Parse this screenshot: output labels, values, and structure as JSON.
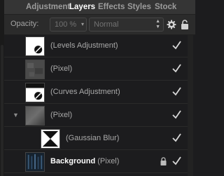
{
  "tabs": [
    {
      "label": "Adjustment",
      "active": false
    },
    {
      "label": "Layers",
      "active": true
    },
    {
      "label": "Effects",
      "active": false
    },
    {
      "label": "Styles",
      "active": false
    },
    {
      "label": "Stock",
      "active": false
    }
  ],
  "toolbar": {
    "opacity_label": "Opacity:",
    "opacity_value": "100 %",
    "blend_mode": "Normal",
    "gear_icon": "gear-icon",
    "lock_icon": "lock-icon"
  },
  "layers": [
    {
      "name": "(Levels Adjustment)",
      "bold_name": "",
      "thumb": "levels-adjustment-thumbnail",
      "visible": true,
      "locked": false,
      "child": false,
      "expandable": false
    },
    {
      "name": "(Pixel)",
      "bold_name": "",
      "thumb": "pixel-thumbnail",
      "visible": true,
      "locked": false,
      "child": false,
      "expandable": false
    },
    {
      "name": "(Curves Adjustment)",
      "bold_name": "",
      "thumb": "curves-adjustment-thumbnail",
      "visible": true,
      "locked": false,
      "child": false,
      "expandable": false
    },
    {
      "name": "(Pixel)",
      "bold_name": "",
      "thumb": "pixel-thumbnail",
      "visible": true,
      "locked": false,
      "child": false,
      "expandable": true
    },
    {
      "name": "(Gaussian Blur)",
      "bold_name": "",
      "thumb": "gaussian-blur-thumbnail",
      "visible": true,
      "locked": false,
      "child": true,
      "expandable": false
    },
    {
      "name": "(Pixel)",
      "bold_name": "Background",
      "thumb": "background-thumbnail",
      "visible": true,
      "locked": true,
      "child": false,
      "expandable": false
    }
  ],
  "colors": {
    "panel_bg": "#1c1c1e",
    "tab_bg": "#353535",
    "active_tab_text": "#ffffff",
    "check": "#d8d8d8"
  }
}
